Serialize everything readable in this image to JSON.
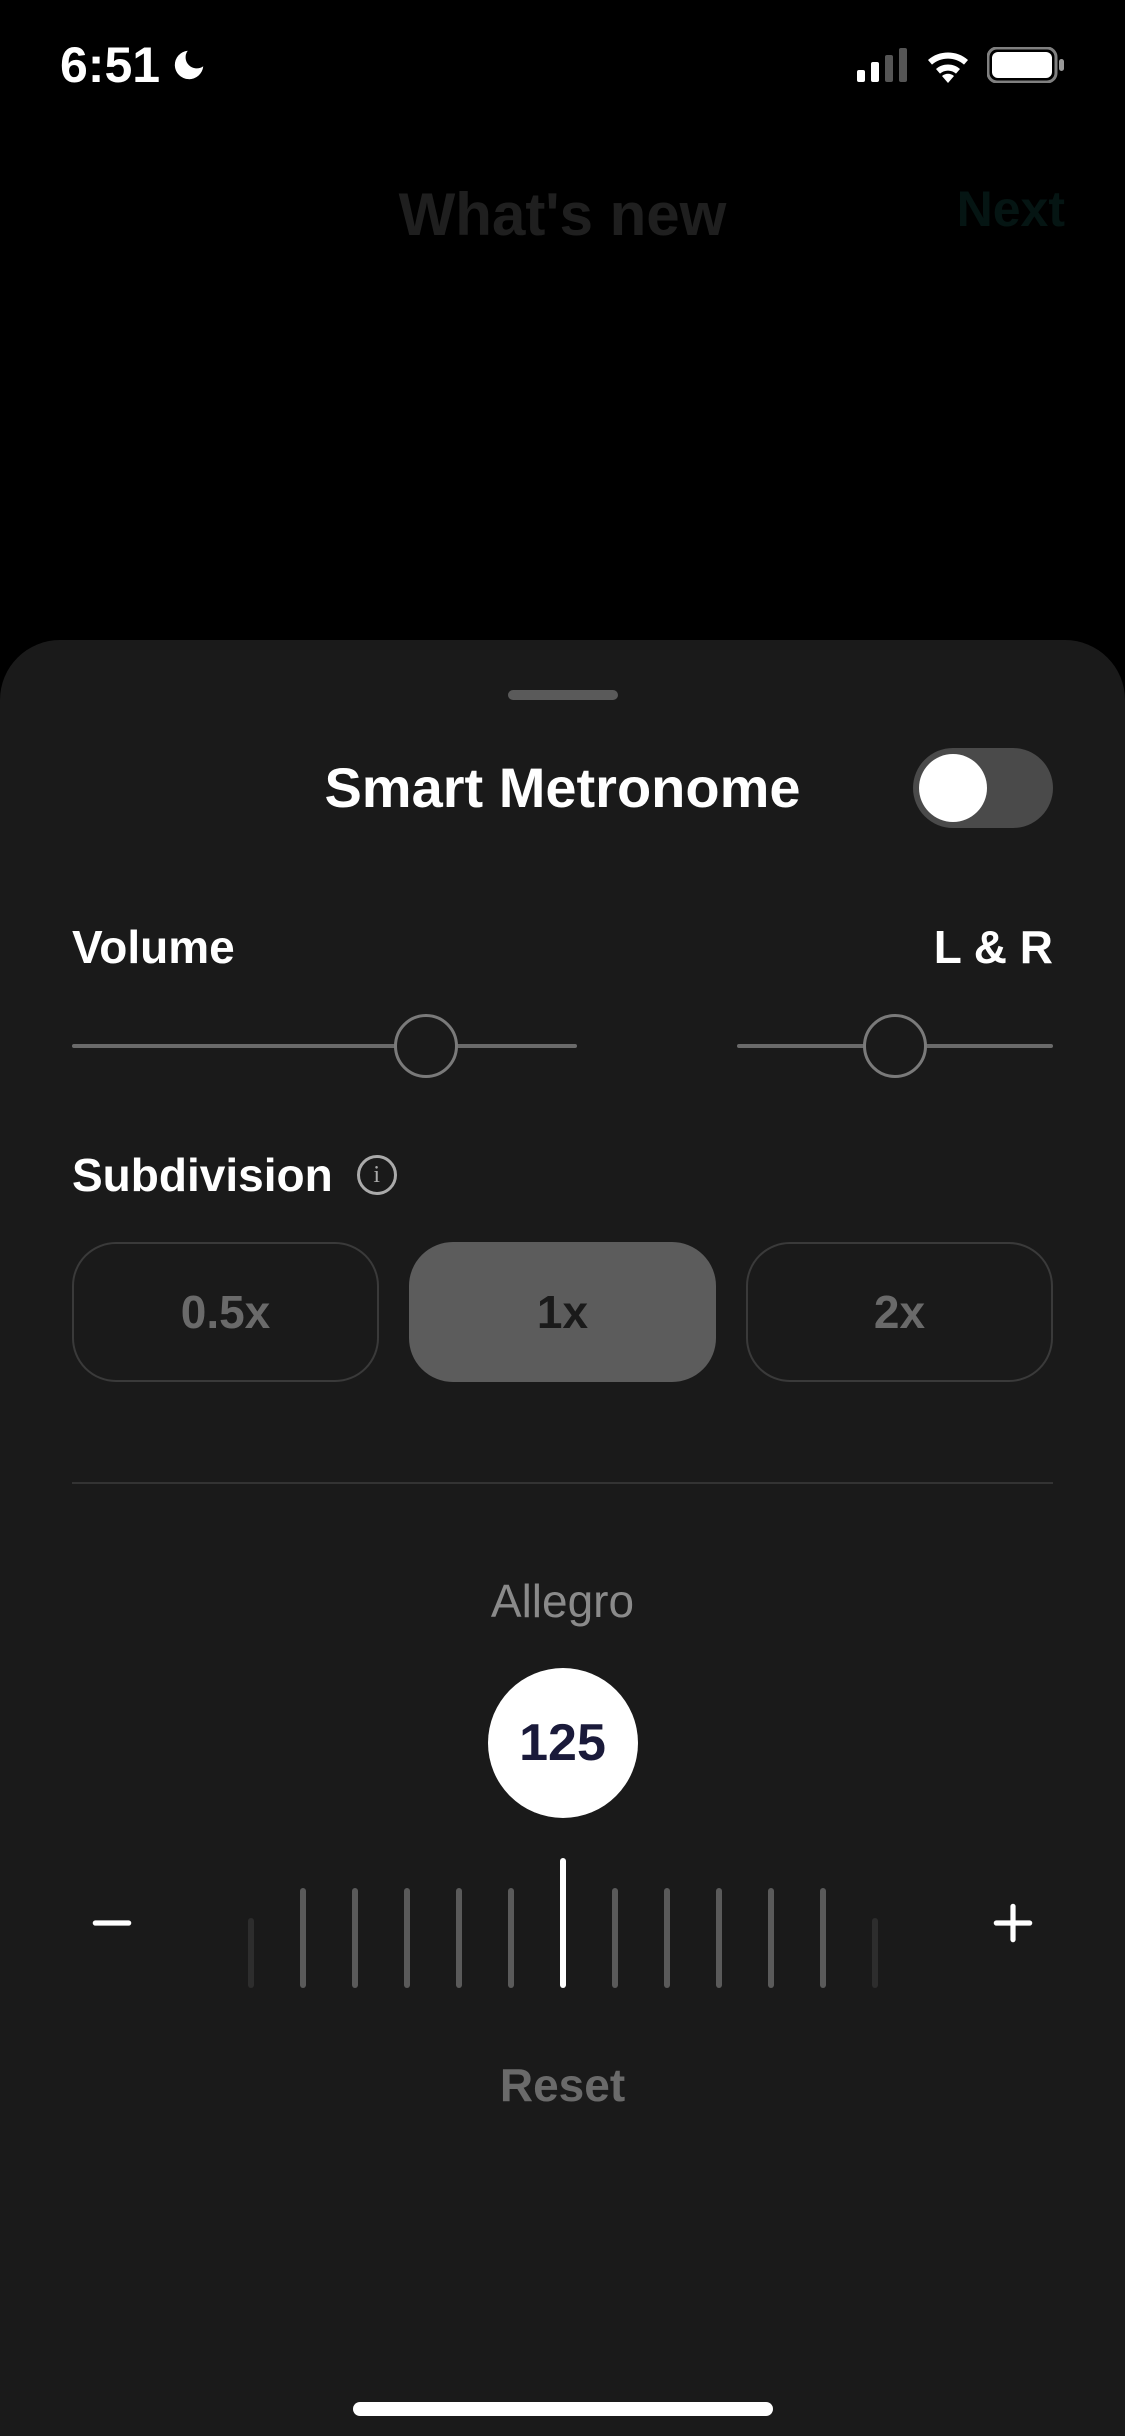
{
  "status": {
    "time": "6:51"
  },
  "background": {
    "title": "What's new",
    "next_label": "Next"
  },
  "sheet": {
    "title": "Smart Metronome",
    "toggle_on": false,
    "volume": {
      "label": "Volume",
      "value_pct": 70
    },
    "lr": {
      "label": "L & R",
      "value_pct": 50
    },
    "subdivision": {
      "label": "Subdivision",
      "options": [
        "0.5x",
        "1x",
        "2x"
      ],
      "selected_index": 1
    },
    "tempo": {
      "marking": "Allegro",
      "bpm": "125",
      "reset_label": "Reset"
    }
  }
}
